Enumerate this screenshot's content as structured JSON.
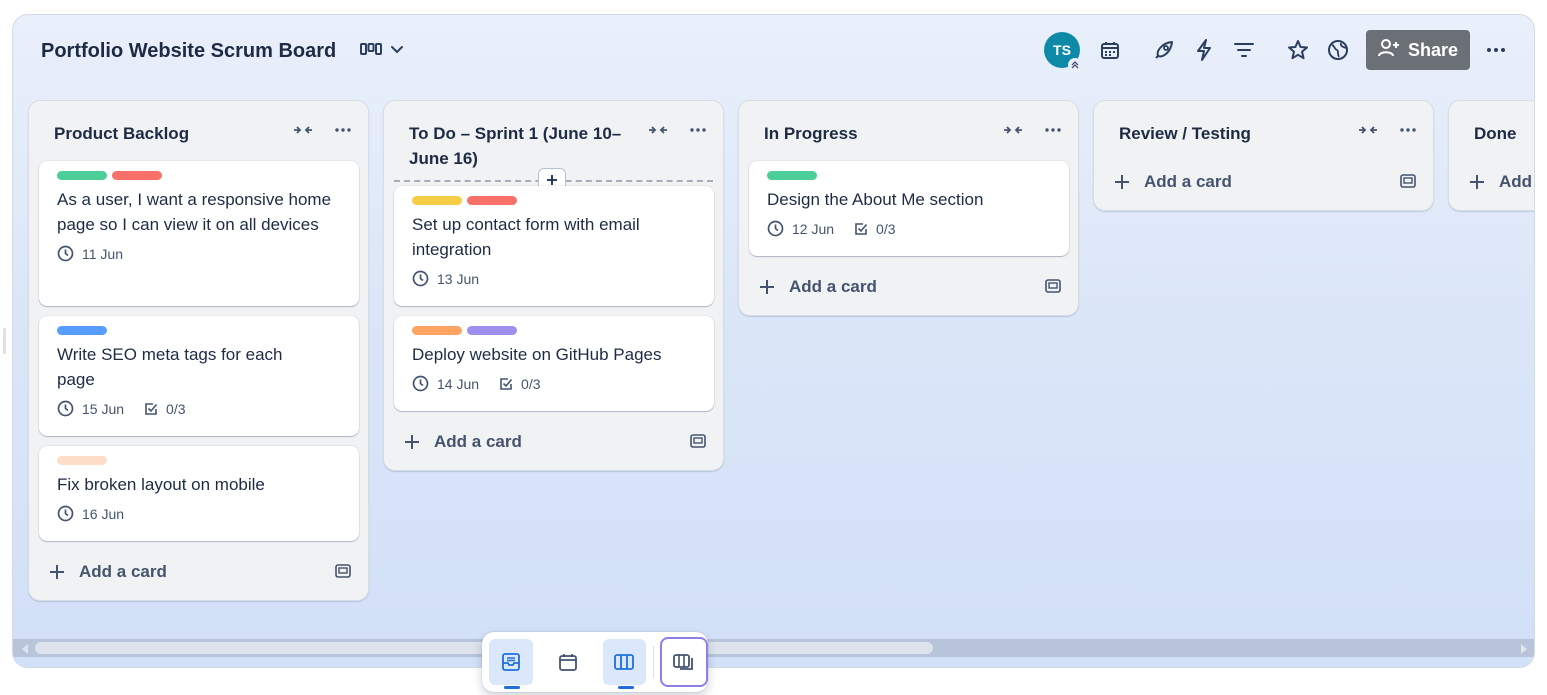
{
  "board": {
    "title": "Portfolio Website Scrum Board",
    "view_icon": "board-view-icon",
    "share_label": "Share"
  },
  "header": {
    "avatar_initials": "TS",
    "icons": [
      "calendar-icon",
      "rocket-icon",
      "lightning-icon",
      "filter-icon",
      "star-icon",
      "globe-icon",
      "more-icon"
    ]
  },
  "lists": [
    {
      "title": "Product Backlog",
      "add_label": "Add a card",
      "cards": [
        {
          "title": "As a user, I want a responsive home page so I can view it on all devices",
          "labels": [
            "#4bce97",
            "#f87168"
          ],
          "date": "11 Jun",
          "checklist": ""
        },
        {
          "title": "Write SEO meta tags for each page",
          "labels": [
            "#579dff"
          ],
          "date": "15 Jun",
          "checklist": "0/3"
        },
        {
          "title": "Fix broken layout on mobile",
          "labels": [
            "#fedec8"
          ],
          "date": "16 Jun",
          "checklist": ""
        }
      ]
    },
    {
      "title": "To Do – Sprint 1 (June 10–June 16)",
      "add_label": "Add a card",
      "cards": [
        {
          "title": "Set up contact form with email integration",
          "labels": [
            "#f5cd47",
            "#f87168"
          ],
          "date": "13 Jun",
          "checklist": ""
        },
        {
          "title": "Deploy website on GitHub Pages",
          "labels": [
            "#fea362",
            "#9f8fef"
          ],
          "date": "14 Jun",
          "checklist": "0/3"
        }
      ]
    },
    {
      "title": "In Progress",
      "add_label": "Add a card",
      "cards": [
        {
          "title": "Design the About Me section",
          "labels": [
            "#4bce97"
          ],
          "date": "12 Jun",
          "checklist": "0/3"
        }
      ]
    },
    {
      "title": "Review / Testing",
      "add_label": "Add a card",
      "cards": []
    },
    {
      "title": "Done",
      "add_label": "Add",
      "cards": []
    }
  ],
  "view_bar": {
    "items": [
      "inbox-icon",
      "calendar-icon",
      "board-icon",
      "switch-boards-icon"
    ]
  }
}
